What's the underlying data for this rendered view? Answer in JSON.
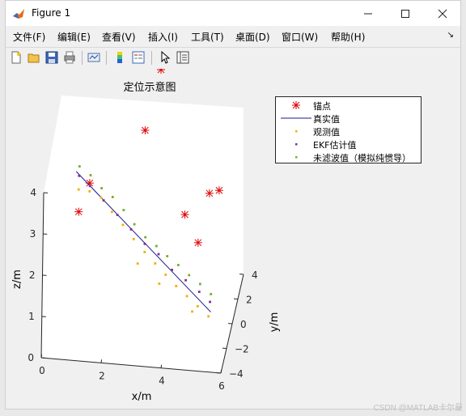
{
  "window": {
    "title": "Figure 1"
  },
  "menus": [
    {
      "label": "文件(F)"
    },
    {
      "label": "编辑(E)"
    },
    {
      "label": "查看(V)"
    },
    {
      "label": "插入(I)"
    },
    {
      "label": "工具(T)"
    },
    {
      "label": "桌面(D)"
    },
    {
      "label": "窗口(W)"
    },
    {
      "label": "帮助(H)"
    }
  ],
  "toolbar": {
    "icons": [
      "new-figure-icon",
      "open-file-icon",
      "save-icon",
      "print-icon",
      "link-plot-icon",
      "insert-colorbar-icon",
      "insert-legend-icon",
      "select-arrow-icon",
      "property-inspector-icon"
    ]
  },
  "colors": {
    "anchor": "#e00000",
    "true_track": "#1a1a8c",
    "observed": "#f0b000",
    "ekf": "#7e2f8e",
    "unfiltered": "#77ac30"
  },
  "chart_data": {
    "type": "scatter",
    "title": "定位示意图",
    "xlabel": "x/m",
    "ylabel": "y/m",
    "zlabel": "z/m",
    "xlim": [
      0,
      6
    ],
    "ylim": [
      -4,
      4
    ],
    "zlim": [
      0,
      4
    ],
    "xticks": [
      "0",
      "2",
      "4",
      "6"
    ],
    "yticks": [
      "-4",
      "-2",
      "0",
      "2",
      "4"
    ],
    "zticks": [
      "0",
      "1",
      "2",
      "3",
      "4"
    ],
    "legend_position": "top-right",
    "series": [
      {
        "name": "锚点",
        "style": "asterisk",
        "color": "#e00000",
        "points": [
          [
            1.0,
            2.0,
            2.5
          ],
          [
            1.0,
            -2.0,
            3.0
          ],
          [
            5.0,
            2.0,
            2.5
          ],
          [
            5.0,
            -2.0,
            2.5
          ],
          [
            3.0,
            0.0,
            4.5
          ],
          [
            1.0,
            2.0,
            5.5
          ],
          [
            4.0,
            2.0,
            6.0
          ],
          [
            3.5,
            0.0,
            6.0
          ],
          [
            5.5,
            0.0,
            3.2
          ],
          [
            4.5,
            -1.5,
            3.0
          ]
        ]
      },
      {
        "name": "真实值",
        "style": "line",
        "color": "#1a1a8c",
        "points": [
          [
            0.5,
            2.5,
            2.6
          ],
          [
            5.5,
            -2.5,
            1.0
          ]
        ]
      },
      {
        "name": "观测值",
        "style": "dot",
        "color": "#f0b000",
        "points": [
          [
            0.6,
            2.4,
            2.2
          ],
          [
            1.0,
            2.0,
            2.3
          ],
          [
            1.4,
            1.9,
            2.2
          ],
          [
            1.8,
            1.5,
            2.0
          ],
          [
            2.2,
            1.2,
            1.8
          ],
          [
            2.6,
            0.8,
            1.6
          ],
          [
            3.0,
            0.5,
            1.4
          ],
          [
            3.4,
            0.0,
            1.3
          ],
          [
            3.8,
            -0.5,
            1.2
          ],
          [
            4.2,
            -1.0,
            1.1
          ],
          [
            4.6,
            -1.4,
            1.0
          ],
          [
            5.0,
            -1.8,
            0.9
          ],
          [
            5.4,
            -2.2,
            0.8
          ],
          [
            2.8,
            0.2,
            1.2
          ],
          [
            3.6,
            -0.6,
            1.0
          ],
          [
            4.8,
            -1.6,
            0.7
          ]
        ]
      },
      {
        "name": "EKF估计值",
        "style": "dot",
        "color": "#7e2f8e",
        "points": [
          [
            0.6,
            2.5,
            2.5
          ],
          [
            1.0,
            2.1,
            2.4
          ],
          [
            1.5,
            1.7,
            2.2
          ],
          [
            2.0,
            1.3,
            2.0
          ],
          [
            2.5,
            0.9,
            1.8
          ],
          [
            3.0,
            0.5,
            1.6
          ],
          [
            3.5,
            0.1,
            1.5
          ],
          [
            4.0,
            -0.4,
            1.3
          ],
          [
            4.5,
            -0.8,
            1.2
          ],
          [
            5.0,
            -1.3,
            1.1
          ],
          [
            5.4,
            -1.7,
            1.0
          ]
        ]
      },
      {
        "name": "未滤波值（模拟纯惯导）",
        "style": "dot",
        "color": "#77ac30",
        "points": [
          [
            0.6,
            2.6,
            2.7
          ],
          [
            1.0,
            2.3,
            2.6
          ],
          [
            1.4,
            2.0,
            2.4
          ],
          [
            1.8,
            1.7,
            2.3
          ],
          [
            2.2,
            1.4,
            2.1
          ],
          [
            2.6,
            1.0,
            1.9
          ],
          [
            3.0,
            0.7,
            1.7
          ],
          [
            3.4,
            0.4,
            1.6
          ],
          [
            3.8,
            0.0,
            1.5
          ],
          [
            4.2,
            -0.3,
            1.4
          ],
          [
            4.6,
            -0.7,
            1.3
          ],
          [
            5.0,
            -1.0,
            1.2
          ],
          [
            5.4,
            -1.4,
            1.1
          ]
        ]
      }
    ]
  },
  "watermark": "CSDN @MATLAB卡尔曼"
}
